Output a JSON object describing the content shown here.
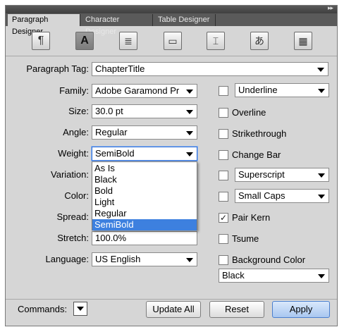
{
  "tabs": [
    "Paragraph Designer",
    "Character Designer",
    "Table Designer"
  ],
  "toolbar_icons": [
    "pilcrow-icon",
    "character-format-icon",
    "text-lines-icon",
    "page-layout-icon",
    "text-frame-icon",
    "asian-character-icon",
    "table-icon"
  ],
  "form": {
    "paragraph_tag_label": "Paragraph Tag:",
    "paragraph_tag_value": "ChapterTitle",
    "family_label": "Family:",
    "family_value": "Adobe Garamond Pr",
    "size_label": "Size:",
    "size_value": "30.0 pt",
    "angle_label": "Angle:",
    "angle_value": "Regular",
    "weight_label": "Weight:",
    "weight_value": "SemiBold",
    "variation_label": "Variation:",
    "color_label": "Color:",
    "spread_label": "Spread:",
    "stretch_label": "Stretch:",
    "stretch_value": "100.0%",
    "language_label": "Language:",
    "language_value": "US English"
  },
  "weight_options": [
    "As Is",
    "Black",
    "Bold",
    "Light",
    "Regular",
    "SemiBold"
  ],
  "weight_selected": "SemiBold",
  "right": {
    "underline_value": "Underline",
    "overline_label": "Overline",
    "strikethrough_label": "Strikethrough",
    "change_bar_label": "Change Bar",
    "superscript_value": "Superscript",
    "small_caps_value": "Small Caps",
    "pair_kern_label": "Pair Kern",
    "pair_kern_checked": true,
    "tsume_label": "Tsume",
    "background_color_label": "Background Color",
    "background_color_value": "Black"
  },
  "footer": {
    "commands_label": "Commands:",
    "update_all": "Update All",
    "reset": "Reset",
    "apply": "Apply"
  }
}
